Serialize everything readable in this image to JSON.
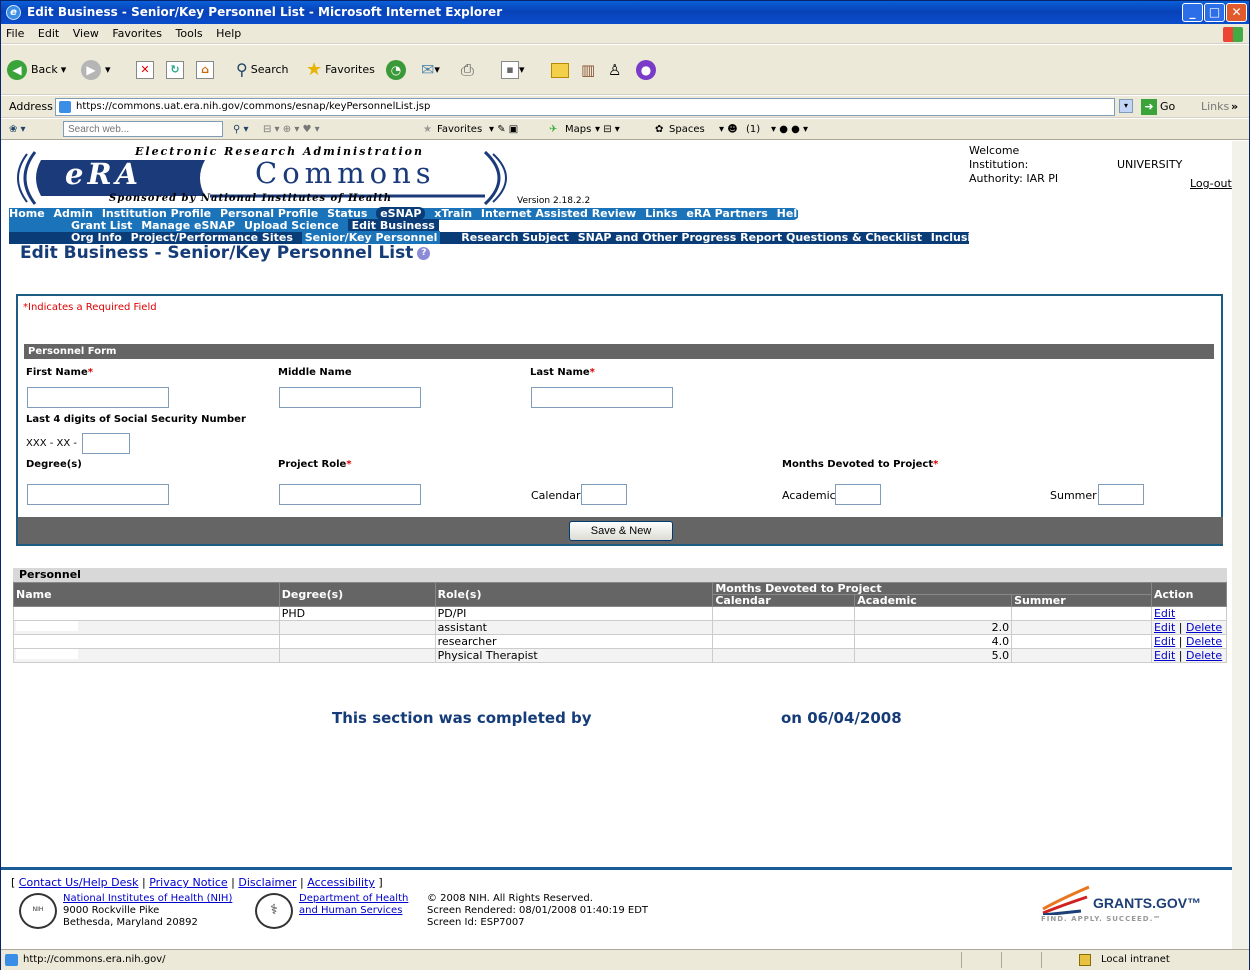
{
  "window": {
    "title": "Edit Business - Senior/Key Personnel List - Microsoft Internet Explorer"
  },
  "menu": [
    "File",
    "Edit",
    "View",
    "Favorites",
    "Tools",
    "Help"
  ],
  "toolbar": {
    "back": "Back",
    "search": "Search",
    "favorites": "Favorites"
  },
  "address": {
    "label": "Address",
    "url": "https://commons.uat.era.nih.gov/commons/esnap/keyPersonnelList.jsp",
    "go": "Go",
    "links": "Links"
  },
  "searchbar": {
    "placeholder": "Search web...",
    "favorites": "Favorites",
    "maps": "Maps",
    "spaces": "Spaces",
    "count": "(1)"
  },
  "header": {
    "logo_top": "Electronic Research Administration",
    "logo_era": "eRA",
    "logo_commons": "Commons",
    "logo_bottom": "Sponsored by National Institutes of Health",
    "version": "Version 2.18.2.2",
    "welcome": "Welcome",
    "institution_label": "Institution:",
    "institution_value": "UNIVERSITY",
    "authority_label": "Authority:",
    "authority_value": "IAR PI",
    "logout": "Log-out"
  },
  "nav": {
    "primary": [
      "Home",
      "Admin",
      "Institution Profile",
      "Personal Profile",
      "Status",
      "eSNAP",
      "xTrain",
      "Internet Assisted Review",
      "Links",
      "eRA Partners",
      "Help"
    ],
    "secondary": [
      "Grant List",
      "Manage eSNAP",
      "Upload Science",
      "Edit Business"
    ],
    "tertiary": [
      "Org Info",
      "Project/Performance Sites",
      "Senior/Key Personnel",
      "Research Subject",
      "SNAP and Other Progress Report Questions & Checklist",
      "Inclusion Enrollment"
    ]
  },
  "page_title": "Edit Business - Senior/Key Personnel List",
  "form": {
    "required_note": "Indicates a Required Field",
    "section_header": "Personnel Form",
    "first_name": "First Name",
    "middle_name": "Middle Name",
    "last_name": "Last Name",
    "ssn_label": "Last 4 digits of Social Security Number",
    "ssn_prefix": "XXX - XX -",
    "degrees": "Degree(s)",
    "project_role": "Project Role",
    "months_devoted": "Months Devoted to Project",
    "calendar": "Calendar",
    "academic": "Academic",
    "summer": "Summer",
    "save_new": "Save & New"
  },
  "personnel": {
    "label": "Personnel",
    "headers": {
      "name": "Name",
      "degrees": "Degree(s)",
      "roles": "Role(s)",
      "months": "Months Devoted to Project",
      "calendar": "Calendar",
      "academic": "Academic",
      "summer": "Summer",
      "action": "Action"
    },
    "rows": [
      {
        "degree": "PHD",
        "role": "PD/PI",
        "calendar": "",
        "academic": "",
        "summer": "",
        "edit": "Edit",
        "delete": ""
      },
      {
        "degree": "",
        "role": "assistant",
        "calendar": "",
        "academic": "2.0",
        "summer": "",
        "edit": "Edit",
        "delete": "Delete"
      },
      {
        "degree": "",
        "role": "researcher",
        "calendar": "",
        "academic": "4.0",
        "summer": "",
        "edit": "Edit",
        "delete": "Delete"
      },
      {
        "degree": "",
        "role": "Physical Therapist",
        "calendar": "",
        "academic": "5.0",
        "summer": "",
        "edit": "Edit",
        "delete": "Delete"
      }
    ]
  },
  "completion": {
    "text": "This section was completed by",
    "date": "on 06/04/2008"
  },
  "footer": {
    "links": [
      "Contact Us/Help Desk",
      "Privacy Notice",
      "Disclaimer",
      "Accessibility"
    ],
    "nih": "National Institutes of Health (NIH)",
    "addr1": "9000 Rockville Pike",
    "addr2": "Bethesda, Maryland 20892",
    "hhs1": "Department of Health",
    "hhs2": "and Human Services",
    "copyright": "© 2008 NIH. All Rights Reserved.",
    "rendered": "Screen Rendered: 08/01/2008 01:40:19 EDT",
    "screen_id": "Screen Id: ESP7007",
    "grants_name": "GRANTS.GOV™",
    "grants_tag": "FIND. APPLY. SUCCEED.℠"
  },
  "status": {
    "url": "http://commons.era.nih.gov/",
    "zone": "Local intranet"
  },
  "colors": {
    "nav_blue": "#1b73b9",
    "nav_dark": "#0a3c78",
    "title_blue": "#153c78",
    "required_red": "#dd0000"
  }
}
